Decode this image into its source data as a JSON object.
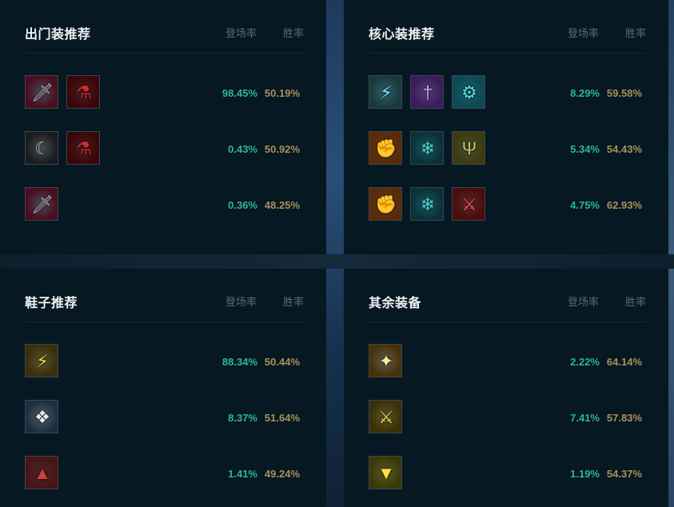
{
  "panels": [
    {
      "title": "出门装推荐",
      "col_pick": "登场率",
      "col_win": "胜率",
      "rows": [
        {
          "items": [
            {
              "icon": "dagger-icon",
              "bg": "#4a0d1e",
              "fg": "#c9b3c6",
              "glyph": "🗡"
            },
            {
              "icon": "potion-icon",
              "bg": "#3a0709",
              "fg": "#d22a2a",
              "glyph": "⚗"
            }
          ],
          "pick": "98.45%",
          "win": "50.19%"
        },
        {
          "items": [
            {
              "icon": "scythe-icon",
              "bg": "#1b1a1c",
              "fg": "#c0c0c0",
              "glyph": "☾"
            },
            {
              "icon": "potion-icon",
              "bg": "#3a0709",
              "fg": "#d22a2a",
              "glyph": "⚗"
            }
          ],
          "pick": "0.43%",
          "win": "50.92%"
        },
        {
          "items": [
            {
              "icon": "dagger-icon",
              "bg": "#4a0d1e",
              "fg": "#c9b3c6",
              "glyph": "🗡"
            }
          ],
          "pick": "0.36%",
          "win": "48.25%"
        }
      ]
    },
    {
      "title": "核心装推荐",
      "col_pick": "登场率",
      "col_win": "胜率",
      "rows": [
        {
          "items": [
            {
              "icon": "lightning-blade-icon",
              "bg": "#1a3a3a",
              "fg": "#7ee8ff",
              "glyph": "⚡"
            },
            {
              "icon": "sword-icon",
              "bg": "#3d1a5c",
              "fg": "#d8a0ff",
              "glyph": "†"
            },
            {
              "icon": "cannon-icon",
              "bg": "#0e4a55",
              "fg": "#4de0e8",
              "glyph": "⚙"
            }
          ],
          "pick": "8.29%",
          "win": "59.58%"
        },
        {
          "items": [
            {
              "icon": "gauntlet-icon",
              "bg": "#5a2a08",
              "fg": "#f09040",
              "glyph": "✊"
            },
            {
              "icon": "frost-claw-icon",
              "bg": "#0a3038",
              "fg": "#4ad8d8",
              "glyph": "❄"
            },
            {
              "icon": "trident-icon",
              "bg": "#3d3a10",
              "fg": "#c8c060",
              "glyph": "Ψ"
            }
          ],
          "pick": "5.34%",
          "win": "54.43%"
        },
        {
          "items": [
            {
              "icon": "gauntlet-icon",
              "bg": "#5a2a08",
              "fg": "#f09040",
              "glyph": "✊"
            },
            {
              "icon": "frost-claw-icon",
              "bg": "#0a3038",
              "fg": "#4ad8d8",
              "glyph": "❄"
            },
            {
              "icon": "red-blade-icon",
              "bg": "#4a0c0c",
              "fg": "#ff5050",
              "glyph": "⚔"
            }
          ],
          "pick": "4.75%",
          "win": "62.93%"
        }
      ]
    },
    {
      "title": "鞋子推荐",
      "col_pick": "登场率",
      "col_win": "胜率",
      "rows": [
        {
          "items": [
            {
              "icon": "armored-boots-icon",
              "bg": "#3a2e0c",
              "fg": "#f5d040",
              "glyph": "⚡"
            }
          ],
          "pick": "88.34%",
          "win": "50.44%"
        },
        {
          "items": [
            {
              "icon": "winged-boots-icon",
              "bg": "#1a3040",
              "fg": "#e8e8f0",
              "glyph": "❖"
            }
          ],
          "pick": "8.37%",
          "win": "51.64%"
        },
        {
          "items": [
            {
              "icon": "red-boots-icon",
              "bg": "#4a1414",
              "fg": "#d04040",
              "glyph": "▲"
            }
          ],
          "pick": "1.41%",
          "win": "49.24%"
        }
      ]
    },
    {
      "title": "其余装备",
      "col_pick": "登场率",
      "col_win": "胜率",
      "rows": [
        {
          "items": [
            {
              "icon": "angel-icon",
              "bg": "#4a3008",
              "fg": "#ffe8a0",
              "glyph": "✦"
            }
          ],
          "pick": "2.22%",
          "win": "64.14%"
        },
        {
          "items": [
            {
              "icon": "golden-blade-icon",
              "bg": "#3a3008",
              "fg": "#ffd840",
              "glyph": "⚔"
            }
          ],
          "pick": "7.41%",
          "win": "57.83%"
        },
        {
          "items": [
            {
              "icon": "triangle-shield-icon",
              "bg": "#3a3808",
              "fg": "#ffe040",
              "glyph": "▼"
            }
          ],
          "pick": "1.19%",
          "win": "54.37%"
        }
      ]
    }
  ]
}
